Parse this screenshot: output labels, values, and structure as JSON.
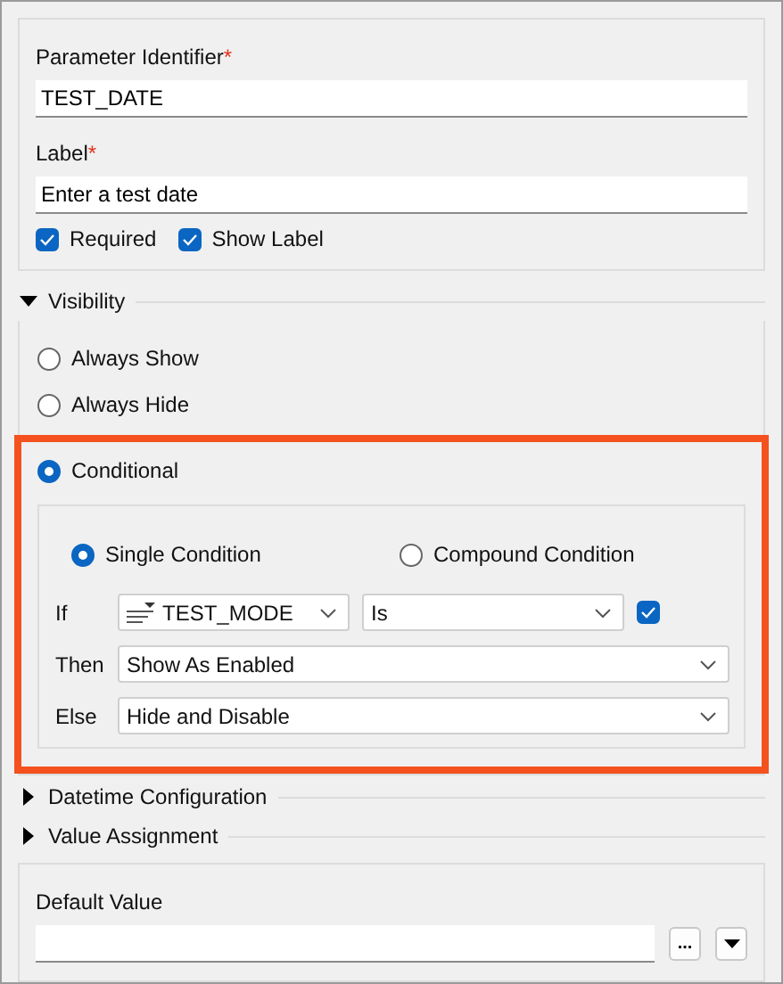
{
  "identifier": {
    "label": "Parameter Identifier",
    "required_mark": "*",
    "value": "TEST_DATE"
  },
  "label_field": {
    "label": "Label",
    "required_mark": "*",
    "value": "Enter a test date"
  },
  "options": [
    {
      "label": "Required",
      "checked": true
    },
    {
      "label": "Show Label",
      "checked": true
    }
  ],
  "visibility": {
    "title": "Visibility",
    "expanded": true,
    "modes": [
      {
        "label": "Always Show",
        "selected": false,
        "highlighted": false
      },
      {
        "label": "Always Hide",
        "selected": false,
        "highlighted": false
      },
      {
        "label": "Conditional",
        "selected": true,
        "highlighted": true
      }
    ],
    "condition_types": [
      {
        "label": "Single Condition",
        "selected": true
      },
      {
        "label": "Compound Condition",
        "selected": false
      }
    ],
    "rows": [
      {
        "label": "If",
        "kind": "test",
        "field": "TEST_MODE",
        "operator": "Is",
        "checked": true
      },
      {
        "label": "Then",
        "kind": "select",
        "value": "Show As Enabled"
      },
      {
        "label": "Else",
        "kind": "select",
        "value": "Hide and Disable"
      }
    ]
  },
  "collapsed_sections": [
    {
      "title": "Datetime Configuration",
      "expanded": false
    },
    {
      "title": "Value Assignment",
      "expanded": false
    }
  ],
  "default_value": {
    "label": "Default Value",
    "browse_button": "..."
  }
}
